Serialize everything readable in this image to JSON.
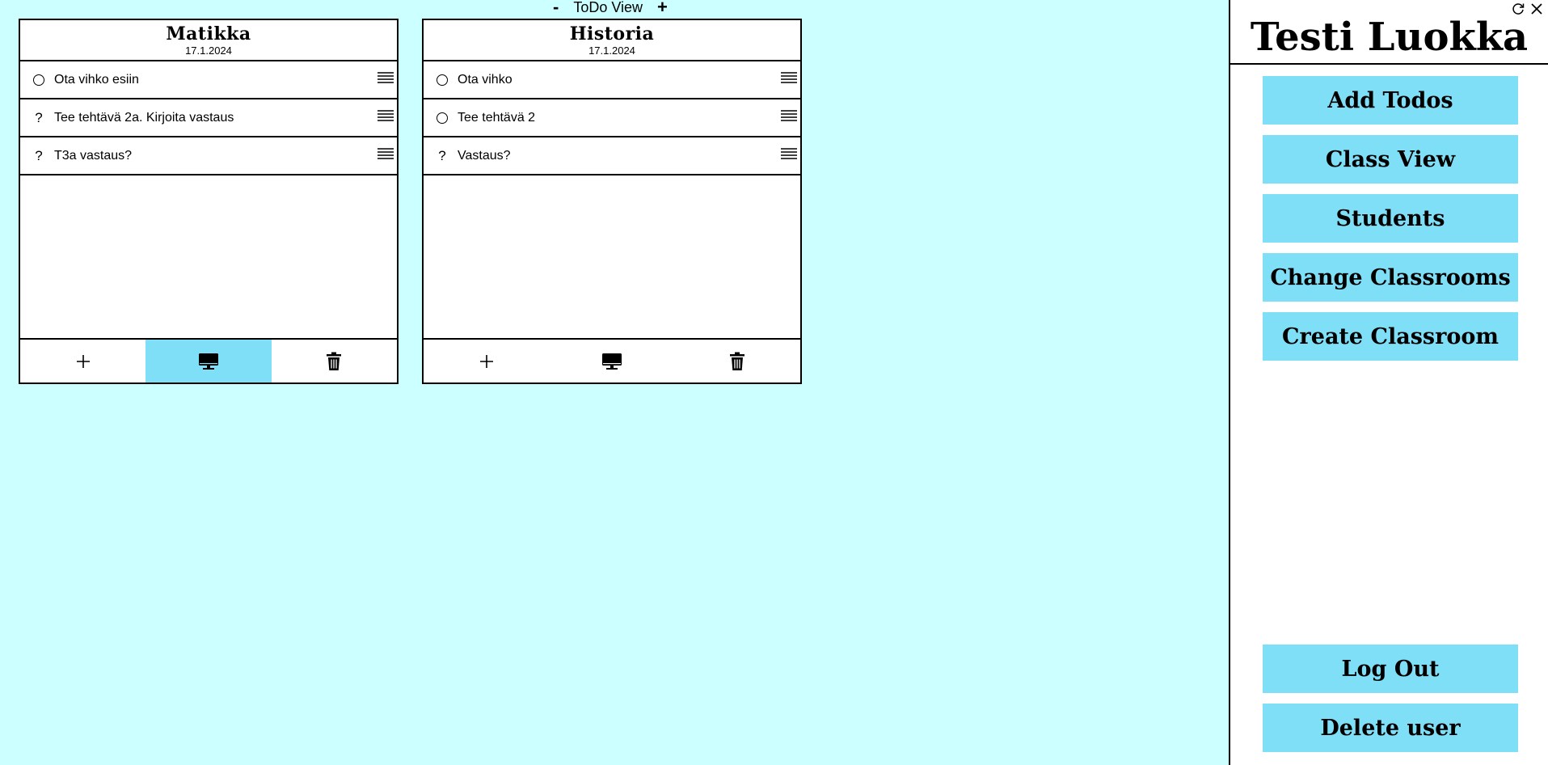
{
  "app": {
    "view_title": "ToDo View",
    "zoom_out": "-",
    "zoom_in": "+"
  },
  "cards": [
    {
      "title": "Matikka",
      "date": "17.1.2024",
      "todos": [
        {
          "status": "circle",
          "text": "Ota vihko esiin"
        },
        {
          "status": "?",
          "text": "Tee tehtävä 2a. Kirjoita vastaus"
        },
        {
          "status": "?",
          "text": "T3a vastaus?"
        }
      ],
      "footer_active": "display"
    },
    {
      "title": "Historia",
      "date": "17.1.2024",
      "todos": [
        {
          "status": "circle",
          "text": "Ota vihko"
        },
        {
          "status": "circle",
          "text": "Tee tehtävä 2"
        },
        {
          "status": "?",
          "text": "Vastaus?"
        }
      ],
      "footer_active": "none"
    }
  ],
  "sidebar": {
    "title": "Testi Luokka",
    "buttons": [
      "Add Todos",
      "Class View",
      "Students",
      "Change Classrooms",
      "Create Classroom"
    ],
    "bottom_buttons": [
      "Log Out",
      "Delete user"
    ]
  },
  "colors": {
    "background": "#ccffff",
    "accent": "#7fdff7"
  },
  "icons": {
    "refresh": "refresh-icon",
    "close": "close-icon",
    "add": "plus-icon",
    "display": "monitor-icon",
    "delete": "trash-icon",
    "drag": "hamburger-icon"
  }
}
